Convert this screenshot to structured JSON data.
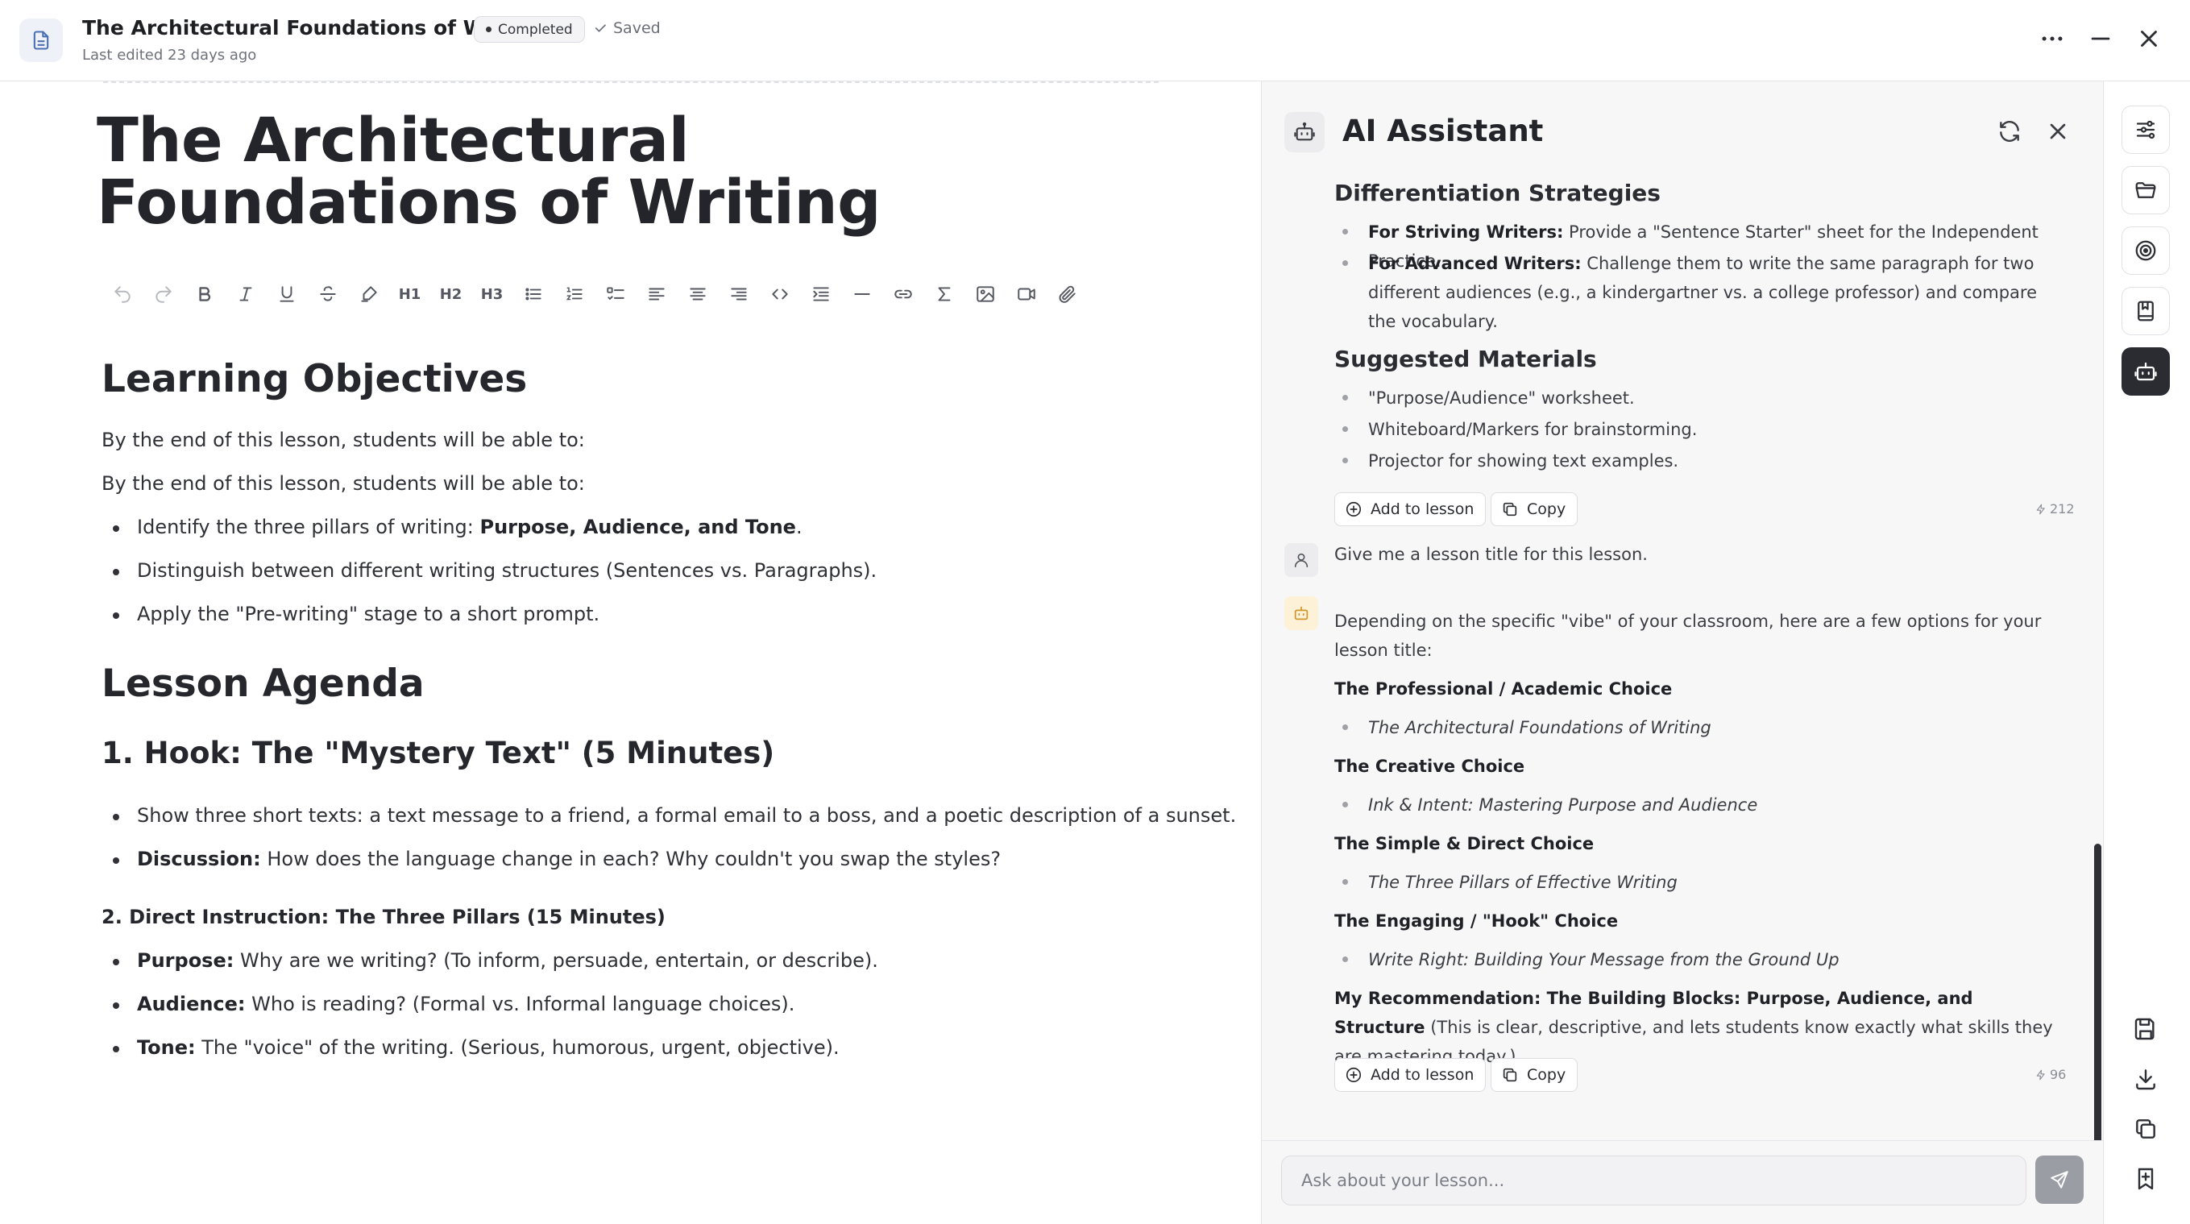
{
  "header": {
    "title": "The Architectural Foundations of Writing",
    "status": "Completed",
    "saved": "Saved",
    "subtitle": "Last edited 23 days ago"
  },
  "editor": {
    "doc_title": "The Architectural Foundations of Writing",
    "toolbar": {
      "h1": "H1",
      "h2": "H2",
      "h3": "H3",
      "tools": [
        "undo-icon",
        "redo-icon",
        "bold-icon",
        "italic-icon",
        "underline-icon",
        "strikethrough-icon",
        "highlight-icon",
        "heading-1",
        "heading-2",
        "heading-3",
        "bullet-list-icon",
        "numbered-list-icon",
        "task-list-icon",
        "align-left-icon",
        "align-center-icon",
        "align-right-icon",
        "code-icon",
        "indent-icon",
        "divider-icon",
        "link-icon",
        "formula-icon",
        "image-icon",
        "video-icon",
        "attachment-icon"
      ]
    },
    "objectives": {
      "heading": "Learning Objectives",
      "intro1": "By the end of this lesson, students will be able to:",
      "intro2": "By the end of this lesson, students will be able to:",
      "item1_text": "Identify the three pillars of writing: ",
      "item1_bold": "Purpose, Audience, and Tone",
      "item1_end": ".",
      "item2": "Distinguish between different writing structures (Sentences vs. Paragraphs).",
      "item3": "Apply the \"Pre-writing\" stage to a short prompt."
    },
    "agenda": {
      "heading": "Lesson Agenda",
      "hook_heading": "1. Hook: The \"Mystery Text\" (5 Minutes)",
      "hook_item1": "Show three short texts: a text message to a friend, a formal email to a boss, and a poetic description of a sunset.",
      "hook_item2_bold": "Discussion:",
      "hook_item2_text": " How does the language change in each? Why couldn't you swap the styles?",
      "instr_heading": "2. Direct Instruction: The Three Pillars (15 Minutes)",
      "purpose_bold": "Purpose:",
      "purpose_text": " Why are we writing? (To inform, persuade, entertain, or describe).",
      "audience_bold": "Audience:",
      "audience_text": " Who is reading? (Formal vs. Informal language choices).",
      "tone_bold": "Tone:",
      "tone_text": " The \"voice\" of the writing. (Serious, humorous, urgent, objective)."
    }
  },
  "panel": {
    "title": "AI Assistant",
    "msg1": {
      "diff_heading": "Differentiation Strategies",
      "striving_bold": "For Striving Writers:",
      "striving_text": " Provide a \"Sentence Starter\" sheet for the Independent Practice.",
      "advanced_bold": "For Advanced Writers:",
      "advanced_text": " Challenge them to write the same paragraph for two different audiences (e.g., a kindergartner vs. a college professor) and compare the vocabulary.",
      "materials_heading": "Suggested Materials",
      "materials": [
        "\"Purpose/Audience\" worksheet.",
        "Whiteboard/Markers for brainstorming.",
        "Projector for showing text examples."
      ],
      "add_label": "Add to lesson",
      "copy_label": "Copy",
      "tokens": "212"
    },
    "user_msg": "Give me a lesson title for this lesson.",
    "msg2": {
      "intro": "Depending on the specific \"vibe\" of your classroom, here are a few options for your lesson title:",
      "opt1_label": "The Professional / Academic Choice",
      "opt1_title": "The Architectural Foundations of Writing",
      "opt2_label": "The Creative Choice",
      "opt2_title": "Ink & Intent: Mastering Purpose and Audience",
      "opt3_label": "The Simple & Direct Choice",
      "opt3_title": "The Three Pillars of Effective Writing",
      "opt4_label": "The Engaging / \"Hook\" Choice",
      "opt4_title": "Write Right: Building Your Message from the Ground Up",
      "rec_bold": "My Recommendation: The Building Blocks: Purpose, Audience, and Structure",
      "rec_text": " (This is clear, descriptive, and lets students know exactly what skills they are mastering today.)",
      "add_label": "Add to lesson",
      "copy_label": "Copy",
      "tokens": "96"
    },
    "composer": {
      "placeholder": "Ask about your lesson..."
    }
  },
  "rail": {
    "items": [
      "sliders-icon",
      "folder-icon",
      "target-icon",
      "book-icon",
      "bot-icon"
    ],
    "bottom": [
      "save-icon",
      "download-icon",
      "duplicate-icon",
      "bookmark-add-icon"
    ]
  }
}
